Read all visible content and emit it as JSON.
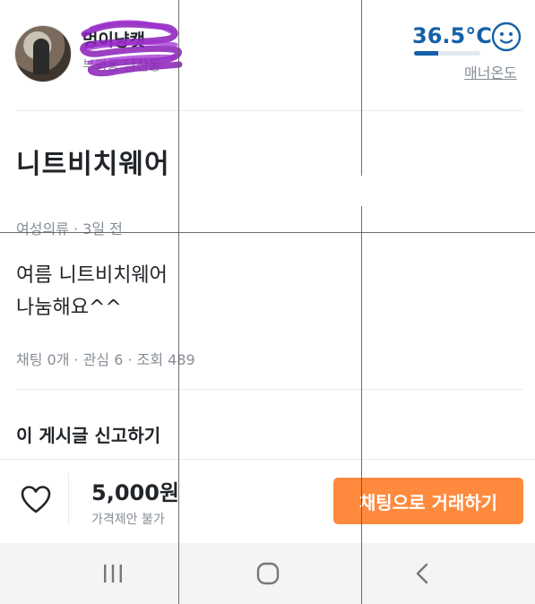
{
  "seller": {
    "name": "멍이냥캣",
    "location": "부평동 남산동",
    "temperature": "36.5°C",
    "temperature_percent": 36.5,
    "manner_label": "매너온도",
    "face_icon": "smiley-face-icon"
  },
  "post": {
    "title": "니트비치웨어",
    "category_line": "여성의류 · 3일 전",
    "description_line1": "여름 니트비치웨어",
    "description_line2": "나눔해요^^",
    "stats": "채팅 0개 · 관심 6 · 조회 489",
    "report": "이 게시글 신고하기"
  },
  "bottom_bar": {
    "price": "5,000원",
    "price_note": "가격제안 불가",
    "chat_button": "채팅으로 거래하기",
    "heart_icon": "heart-outline-icon"
  },
  "system_nav": {
    "recents_icon": "recent-apps-icon",
    "home_icon": "home-icon",
    "back_icon": "back-icon"
  },
  "colors": {
    "accent_orange": "#ff8a3d",
    "temperature_blue": "#1561a9",
    "muted_text": "#868e96"
  }
}
